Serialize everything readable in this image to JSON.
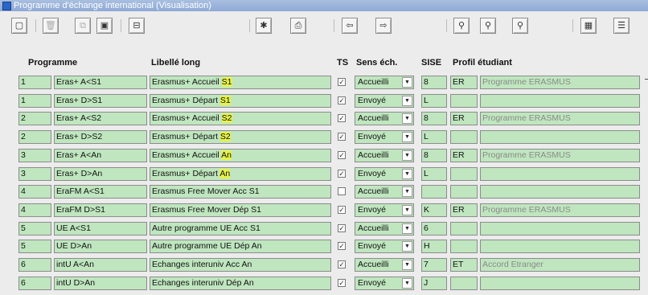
{
  "window": {
    "title": "Programme d'échange international (Visualisation)"
  },
  "toolbar": {
    "buttons": [
      {
        "name": "new-doc-button",
        "glyph": "▢",
        "disabled": false
      },
      {
        "name": "delete-button",
        "glyph": "🗑",
        "disabled": true
      },
      {
        "name": "copy-button",
        "glyph": "⧉",
        "disabled": true
      },
      {
        "name": "save-button",
        "glyph": "▣",
        "disabled": false
      },
      {
        "name": "form-button",
        "glyph": "⊟",
        "disabled": false
      },
      {
        "name": "eraser-button",
        "glyph": "✱",
        "disabled": false
      },
      {
        "name": "print-button",
        "glyph": "⎙",
        "disabled": false
      },
      {
        "name": "previous-button",
        "glyph": "⇦",
        "disabled": false
      },
      {
        "name": "next-button",
        "glyph": "⇨",
        "disabled": false
      },
      {
        "name": "search-button",
        "glyph": "⚲",
        "disabled": false
      },
      {
        "name": "query-button",
        "glyph": "⚲",
        "disabled": false
      },
      {
        "name": "filter-button",
        "glyph": "⚲",
        "disabled": false
      },
      {
        "name": "view-button",
        "glyph": "▦",
        "disabled": false
      },
      {
        "name": "list-button",
        "glyph": "☰",
        "disabled": false
      }
    ]
  },
  "headers": {
    "programme": "Programme",
    "libelle": "Libellé long",
    "ts": "TS",
    "sens": "Sens éch.",
    "sise": "SISE",
    "profil": "Profil étudiant"
  },
  "rows": [
    {
      "num": "1",
      "code": "Eras+ A<S1",
      "libelle_main": "Erasmus+ Accueil ",
      "libelle_hl": "S1",
      "ts": true,
      "sens": "Accueilli",
      "sise": "8",
      "profil_code": "ER",
      "profil_label": "Programme ERASMUS"
    },
    {
      "num": "1",
      "code": "Eras+ D>S1",
      "libelle_main": "Erasmus+ Départ ",
      "libelle_hl": "S1",
      "ts": true,
      "sens": "Envoyé",
      "sise": "L",
      "profil_code": "",
      "profil_label": ""
    },
    {
      "num": "2",
      "code": "Eras+ A<S2",
      "libelle_main": "Erasmus+ Accueil ",
      "libelle_hl": "S2",
      "ts": true,
      "sens": "Accueilli",
      "sise": "8",
      "profil_code": "ER",
      "profil_label": "Programme ERASMUS"
    },
    {
      "num": "2",
      "code": "Eras+ D>S2",
      "libelle_main": "Erasmus+ Départ ",
      "libelle_hl": "S2",
      "ts": true,
      "sens": "Envoyé",
      "sise": "L",
      "profil_code": "",
      "profil_label": ""
    },
    {
      "num": "3",
      "code": "Eras+ A<An",
      "libelle_main": "Erasmus+ Accueil ",
      "libelle_hl": "An",
      "ts": true,
      "sens": "Accueilli",
      "sise": "8",
      "profil_code": "ER",
      "profil_label": "Programme ERASMUS"
    },
    {
      "num": "3",
      "code": "Eras+ D>An",
      "libelle_main": "Erasmus+ Départ ",
      "libelle_hl": "An",
      "ts": true,
      "sens": "Envoyé",
      "sise": "L",
      "profil_code": "",
      "profil_label": ""
    },
    {
      "num": "4",
      "code": "EraFM A<S1",
      "libelle_main": "Erasmus Free Mover Acc S1",
      "libelle_hl": "",
      "ts": false,
      "sens": "Accueilli",
      "sise": "",
      "profil_code": "",
      "profil_label": ""
    },
    {
      "num": "4",
      "code": "EraFM D>S1",
      "libelle_main": "Erasmus Free Mover Dép S1",
      "libelle_hl": "",
      "ts": true,
      "sens": "Envoyé",
      "sise": "K",
      "profil_code": "ER",
      "profil_label": "Programme ERASMUS"
    },
    {
      "num": "5",
      "code": "UE A<S1",
      "libelle_main": "Autre programme UE Acc S1",
      "libelle_hl": "",
      "ts": true,
      "sens": "Accueilli",
      "sise": "6",
      "profil_code": "",
      "profil_label": ""
    },
    {
      "num": "5",
      "code": "UE D>An",
      "libelle_main": "Autre programme UE Dép An",
      "libelle_hl": "",
      "ts": true,
      "sens": "Envoyé",
      "sise": "H",
      "profil_code": "",
      "profil_label": ""
    },
    {
      "num": "6",
      "code": "intU A<An",
      "libelle_main": "Echanges interuniv Acc An",
      "libelle_hl": "",
      "ts": true,
      "sens": "Accueilli",
      "sise": "7",
      "profil_code": "ET",
      "profil_label": "Accord Etranger"
    },
    {
      "num": "6",
      "code": "intU D>An",
      "libelle_main": "Echanges interuniv Dép An",
      "libelle_hl": "",
      "ts": true,
      "sens": "Envoyé",
      "sise": "J",
      "profil_code": "",
      "profil_label": ""
    }
  ]
}
